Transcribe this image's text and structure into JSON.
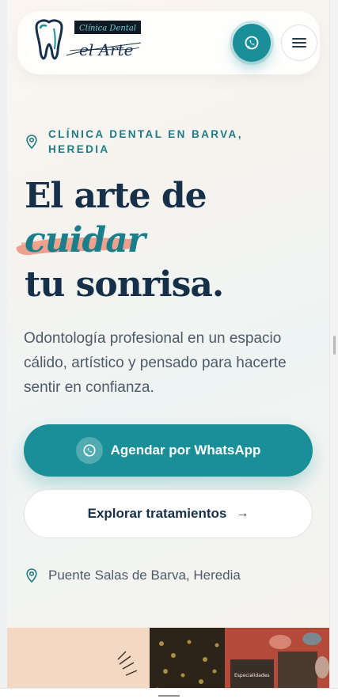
{
  "header": {
    "logo_top": "Clínica Dental",
    "logo_main": "el Arte",
    "whatsapp_icon": "whatsapp-icon",
    "menu_icon": "hamburger-menu-icon"
  },
  "hero": {
    "location_label": "CLÍNICA DENTAL EN BARVA, HEREDIA",
    "headline_line1": "El arte de",
    "headline_highlight": "cuidar",
    "headline_line3": "tu sonrisa.",
    "description": "Odontología profesional en un espacio cálido, artístico y pensado para hacerte sentir en confianza.",
    "primary_button": "Agendar por WhatsApp",
    "secondary_button": "Explorar tratamientos",
    "secondary_arrow": "→",
    "address": "Puente Salas de Barva, Heredia"
  },
  "photo": {
    "sign_text": "Especialidades"
  },
  "colors": {
    "accent": "#1a8f98",
    "navy": "#16304a",
    "brush": "#e8846e"
  }
}
